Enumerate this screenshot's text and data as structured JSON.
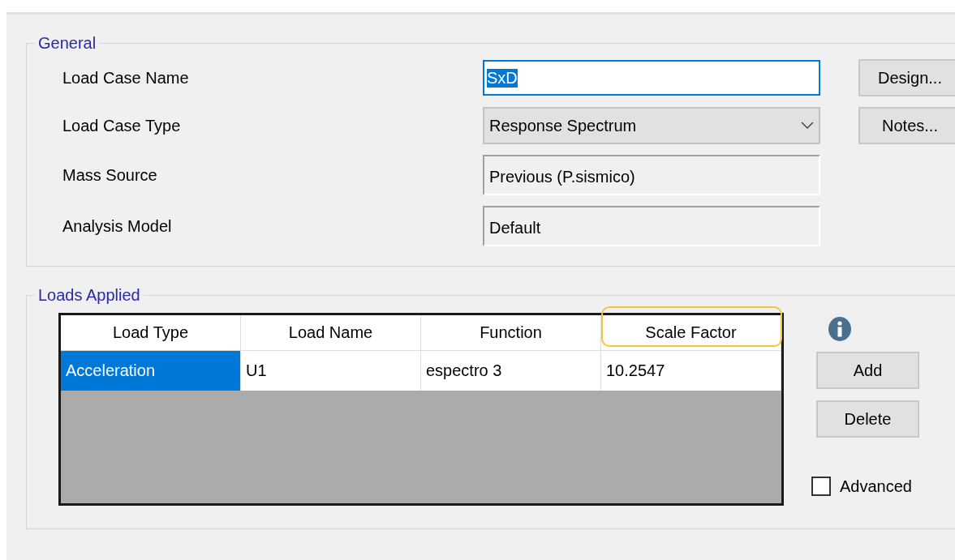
{
  "general": {
    "legend": "General",
    "fields": [
      {
        "kind": "text",
        "label": "Load Case Name",
        "value": "SxD",
        "text_selected": true,
        "focused": true
      },
      {
        "kind": "dropdown",
        "label": "Load Case Type",
        "value": "Response Spectrum"
      },
      {
        "kind": "readonly",
        "label": "Mass Source",
        "value": "Previous  (P.sismico)"
      },
      {
        "kind": "readonly",
        "label": "Analysis Model",
        "value": "Default"
      }
    ],
    "buttons": [
      "Design...",
      "Notes..."
    ]
  },
  "loads_applied": {
    "legend": "Loads Applied",
    "table": {
      "columns": [
        "Load Type",
        "Load Name",
        "Function",
        "Scale Factor"
      ],
      "rows": [
        {
          "cells": [
            {
              "text": "Acceleration",
              "selected": true
            },
            {
              "text": "U1",
              "selected": false
            },
            {
              "text": "espectro 3",
              "selected": false
            },
            {
              "text": "10.2547",
              "selected": false
            }
          ]
        }
      ]
    },
    "buttons": [
      "Add",
      "Delete"
    ],
    "advanced": {
      "label": "Advanced",
      "checked": false
    }
  }
}
